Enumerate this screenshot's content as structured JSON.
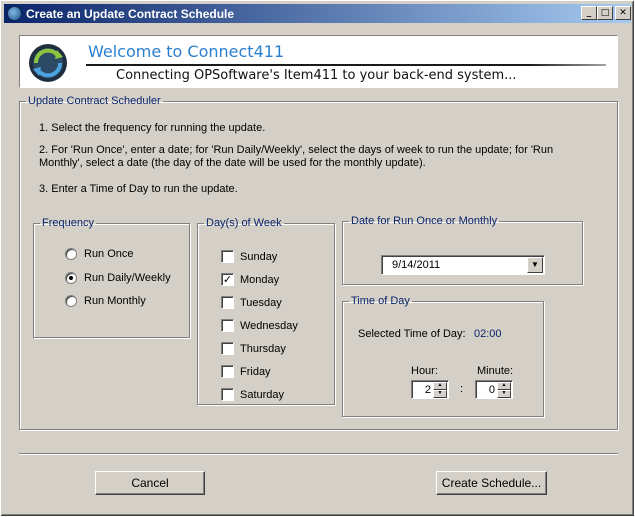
{
  "window": {
    "title": "Create an Update Contract Schedule",
    "controls": {
      "minimize": "_",
      "maximize": "□",
      "close": "✕"
    }
  },
  "banner": {
    "welcome": "Welcome to Connect411",
    "tagline": "Connecting OPSoftware's Item411 to your back-end system...",
    "logo_icon": "connect411-logo-icon"
  },
  "scheduler": {
    "legend": "Update Contract Scheduler",
    "instructions": [
      "1. Select the frequency for running the update.",
      "2. For 'Run Once', enter a date; for 'Run Daily/Weekly', select the days of week to run the update; for 'Run Monthly', select a date (the day of the date will be used for the monthly update).",
      "3. Enter a Time of Day to run the update."
    ]
  },
  "frequency": {
    "legend": "Frequency",
    "options": [
      {
        "label": "Run Once",
        "checked": false
      },
      {
        "label": "Run Daily/Weekly",
        "checked": true
      },
      {
        "label": "Run Monthly",
        "checked": false
      }
    ]
  },
  "days": {
    "legend": "Day(s) of Week",
    "items": [
      {
        "label": "Sunday",
        "checked": false
      },
      {
        "label": "Monday",
        "checked": true
      },
      {
        "label": "Tuesday",
        "checked": false
      },
      {
        "label": "Wednesday",
        "checked": false
      },
      {
        "label": "Thursday",
        "checked": false
      },
      {
        "label": "Friday",
        "checked": false
      },
      {
        "label": "Saturday",
        "checked": false
      }
    ]
  },
  "date": {
    "legend": "Date for Run Once or Monthly",
    "value": "9/14/2011",
    "dropdown_icon": "chevron-down-icon"
  },
  "time": {
    "legend": "Time of Day",
    "selected_label": "Selected Time of Day:",
    "selected_value": "02:00",
    "hour_label": "Hour:",
    "hour_value": "2",
    "separator": ":",
    "minute_label": "Minute:",
    "minute_value": "0"
  },
  "buttons": {
    "cancel": "Cancel",
    "create": "Create Schedule..."
  },
  "colors": {
    "title_gradient_start": "#0a246a",
    "title_gradient_end": "#a6caf0",
    "legend_text": "#0a246a",
    "welcome_text": "#2b7fd1",
    "time_value_text": "#0a246a"
  }
}
